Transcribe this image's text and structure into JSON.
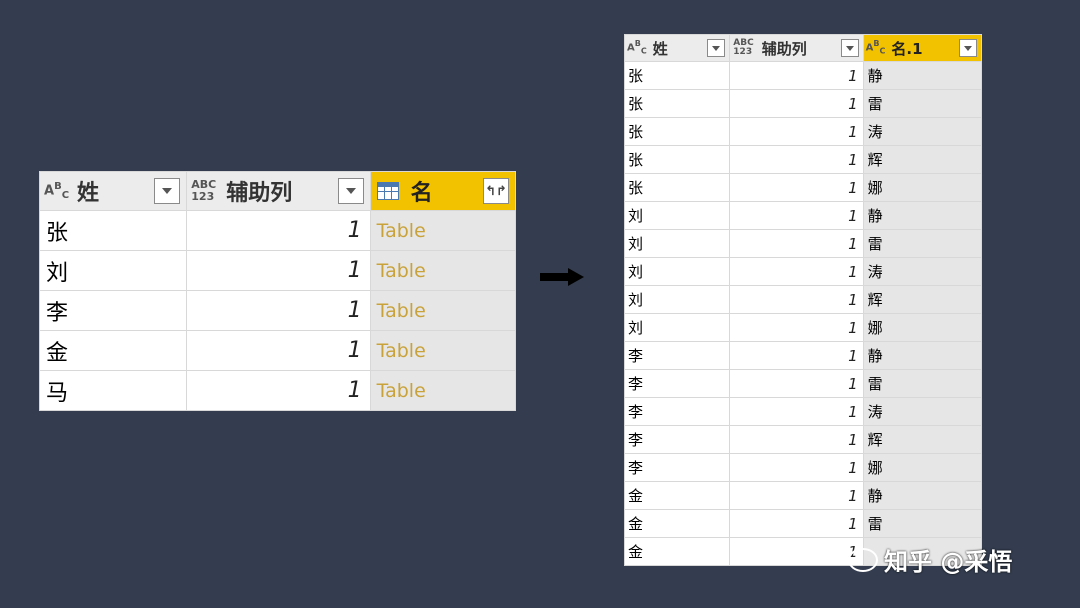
{
  "left_table": {
    "columns": [
      {
        "type_icon": "ABC",
        "label": "姓"
      },
      {
        "type_icon": "ABC123",
        "label": "辅助列"
      },
      {
        "type_icon": "table-icon",
        "label": "名"
      }
    ],
    "rows": [
      [
        "张",
        "1",
        "Table"
      ],
      [
        "刘",
        "1",
        "Table"
      ],
      [
        "李",
        "1",
        "Table"
      ],
      [
        "金",
        "1",
        "Table"
      ],
      [
        "马",
        "1",
        "Table"
      ]
    ]
  },
  "arrow": "right-arrow",
  "right_table": {
    "columns": [
      {
        "type_icon": "ABC",
        "label": "姓"
      },
      {
        "type_icon": "ABC123",
        "label": "辅助列"
      },
      {
        "type_icon": "ABC",
        "label": "名.1"
      }
    ],
    "rows": [
      [
        "张",
        "1",
        "静"
      ],
      [
        "张",
        "1",
        "雷"
      ],
      [
        "张",
        "1",
        "涛"
      ],
      [
        "张",
        "1",
        "辉"
      ],
      [
        "张",
        "1",
        "娜"
      ],
      [
        "刘",
        "1",
        "静"
      ],
      [
        "刘",
        "1",
        "雷"
      ],
      [
        "刘",
        "1",
        "涛"
      ],
      [
        "刘",
        "1",
        "辉"
      ],
      [
        "刘",
        "1",
        "娜"
      ],
      [
        "李",
        "1",
        "静"
      ],
      [
        "李",
        "1",
        "雷"
      ],
      [
        "李",
        "1",
        "涛"
      ],
      [
        "李",
        "1",
        "辉"
      ],
      [
        "李",
        "1",
        "娜"
      ],
      [
        "金",
        "1",
        "静"
      ],
      [
        "金",
        "1",
        "雷"
      ],
      [
        "金",
        "1",
        ""
      ]
    ]
  },
  "watermark": "知乎 @采悟",
  "colors": {
    "background": "#333d4f",
    "selected_header": "#f2c200",
    "table_link": "#c9a23a"
  }
}
